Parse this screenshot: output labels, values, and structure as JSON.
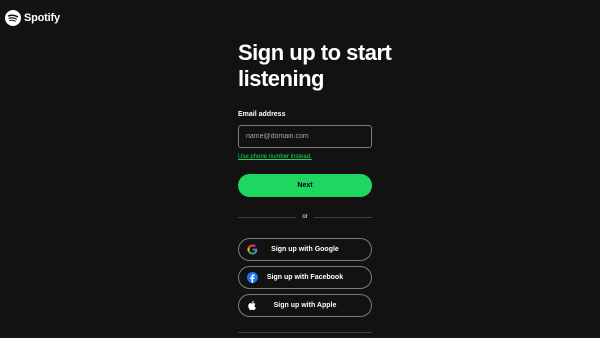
{
  "brand": {
    "name": "Spotify",
    "accent_color": "#1ed760",
    "background_color": "#121212"
  },
  "signup": {
    "title": "Sign up to start listening",
    "email_label": "Email address",
    "email_placeholder": "name@domain.com",
    "email_value": "",
    "phone_link": "Use phone number instead.",
    "next_label": "Next",
    "divider_text": "or"
  },
  "social": [
    {
      "label": "Sign up with Google",
      "icon": "google-icon"
    },
    {
      "label": "Sign up with Facebook",
      "icon": "facebook-icon"
    },
    {
      "label": "Sign up with Apple",
      "icon": "apple-icon"
    }
  ]
}
